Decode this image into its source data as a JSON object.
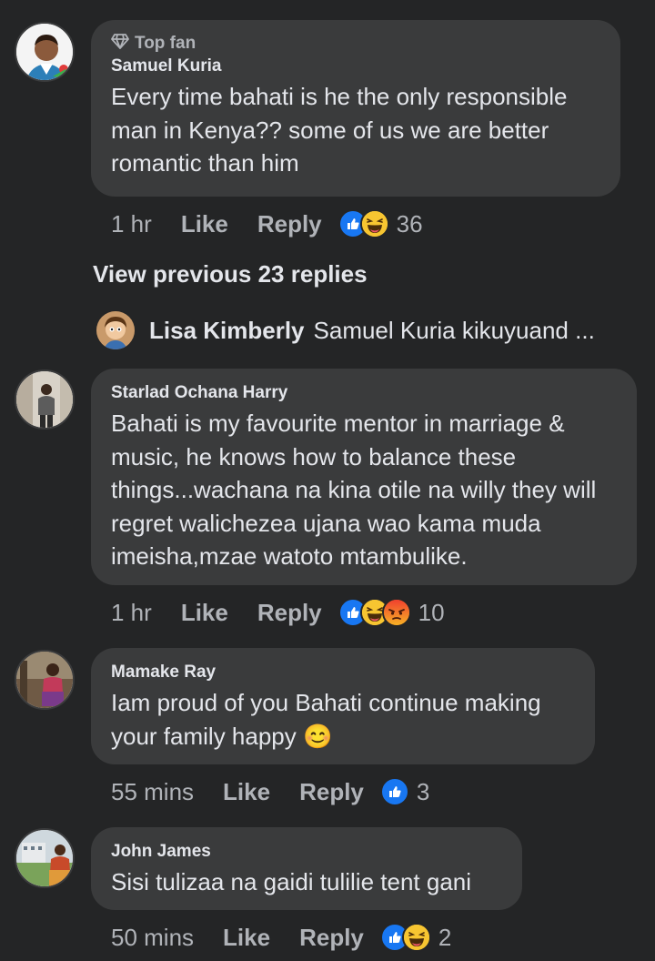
{
  "comments": [
    {
      "badge": "Top fan",
      "author": "Samuel Kuria",
      "text": "Every time bahati is he the only responsible man in Kenya?? some of us we are better romantic than him",
      "time": "1 hr",
      "like": "Like",
      "reply": "Reply",
      "reactions": [
        "like-icon",
        "haha-icon"
      ],
      "count": "36"
    },
    {
      "author": "Starlad Ochana Harry",
      "text": "Bahati is my favourite mentor in marriage & music, he knows how to balance these things...wachana na kina otile na willy they will regret walichezea ujana wao kama muda imeisha,mzae watoto mtambulike.",
      "time": "1 hr",
      "like": "Like",
      "reply": "Reply",
      "reactions": [
        "like-icon",
        "haha-icon",
        "angry-icon"
      ],
      "count": "10"
    },
    {
      "author": "Mamake Ray",
      "text": "Iam proud of you Bahati continue making your family happy",
      "emoji": "😊",
      "time": "55 mins",
      "like": "Like",
      "reply": "Reply",
      "reactions": [
        "like-icon"
      ],
      "count": "3"
    },
    {
      "author": "John James",
      "text": "Sisi tulizaa na gaidi tulilie tent gani",
      "time": "50 mins",
      "like": "Like",
      "reply": "Reply",
      "reactions": [
        "like-icon",
        "haha-icon"
      ],
      "count": "2"
    }
  ],
  "thread": {
    "view_previous": "View previous 23 replies",
    "preview_author": "Lisa Kimberly",
    "preview_text": "Samuel Kuria kikuyuand ..."
  },
  "colors": {
    "background": "#242526",
    "bubble": "#3a3b3c",
    "text": "#e4e6eb",
    "muted": "#b0b3b8",
    "like_blue": "#1877f2",
    "haha_yellow": "#f7c531",
    "angry_red": "#e9710f"
  }
}
